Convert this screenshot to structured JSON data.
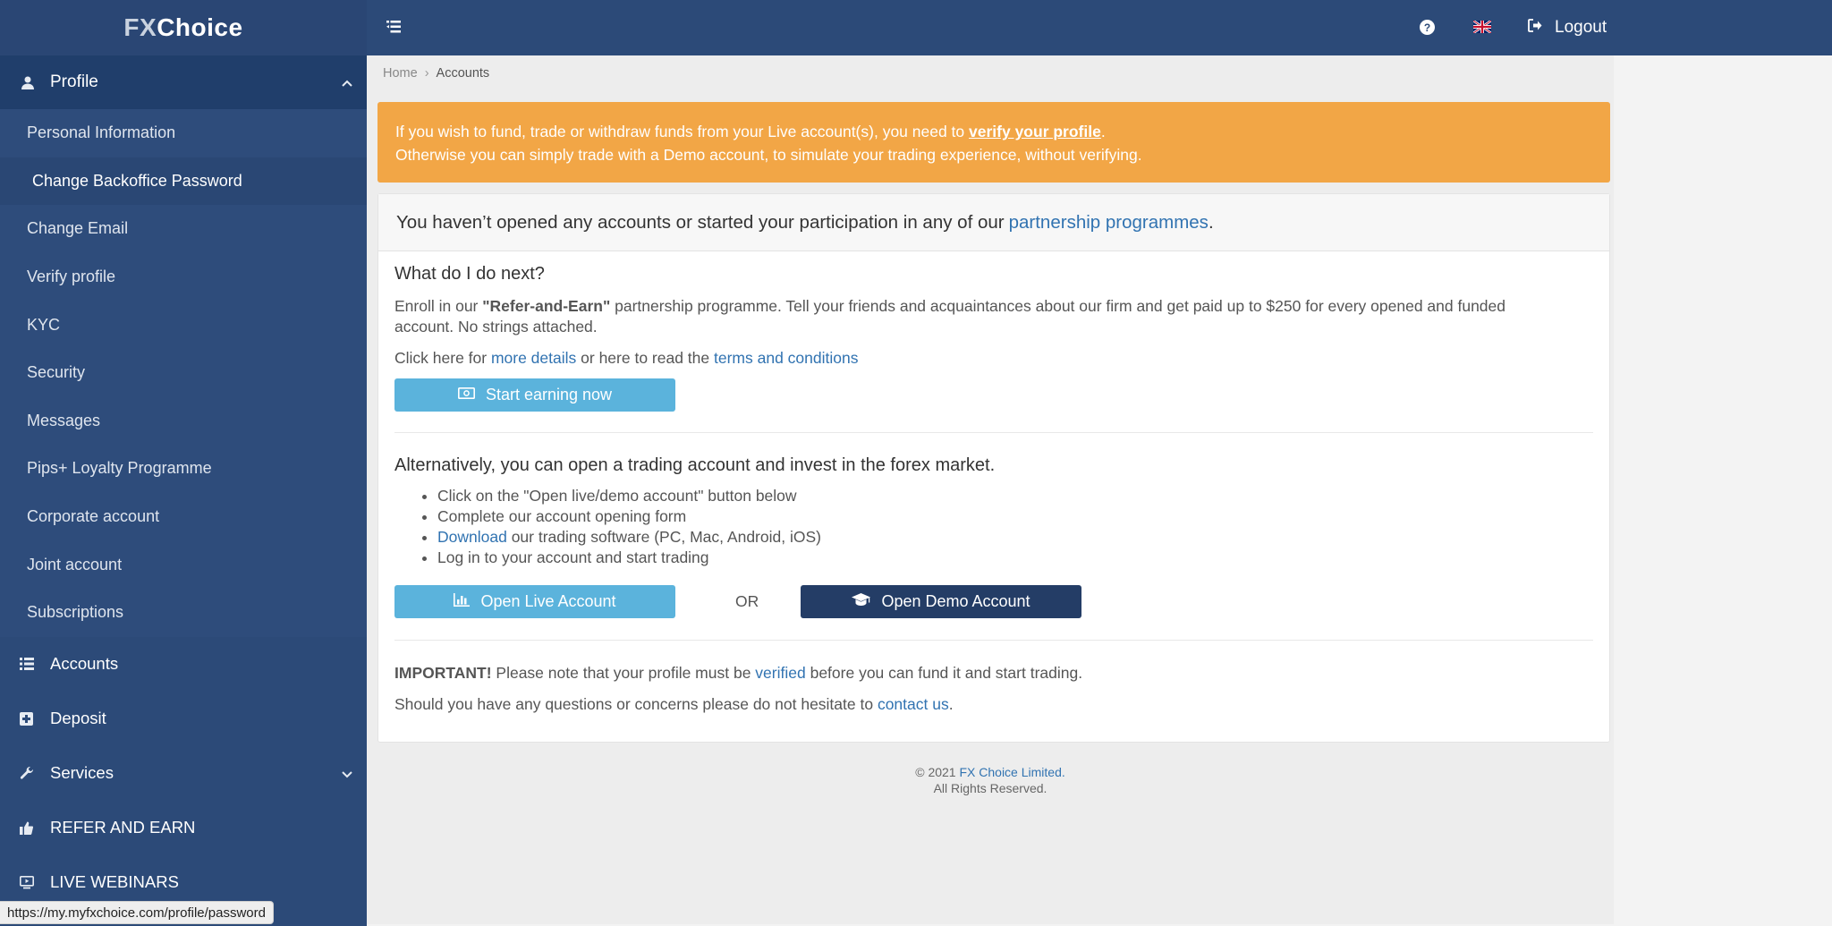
{
  "brand": {
    "fx": "FX",
    "choice": "Choice"
  },
  "sidebar": {
    "profile_label": "Profile",
    "profile_items": [
      "Personal Information",
      "Change Backoffice Password",
      "Change Email",
      "Verify profile",
      "KYC",
      "Security",
      "Messages",
      "Pips+ Loyalty Programme",
      "Corporate account",
      "Joint account",
      "Subscriptions"
    ],
    "accounts_label": "Accounts",
    "deposit_label": "Deposit",
    "services_label": "Services",
    "refer_label": "REFER AND EARN",
    "webinars_label": "LIVE WEBINARS"
  },
  "topbar": {
    "help": "?",
    "logout_label": "Logout"
  },
  "breadcrumb": {
    "home": "Home",
    "separator": "›",
    "current": "Accounts"
  },
  "alert": {
    "line1_prefix": "If you wish to fund, trade or withdraw funds from your Live account(s), you need to ",
    "line1_link": "verify your profile",
    "line1_suffix": ".",
    "line2": "Otherwise you can simply trade with a Demo account, to simulate your trading experience, without verifying."
  },
  "panel": {
    "head_prefix": "You haven’t opened any accounts or started your participation in any of our ",
    "head_link": "partnership programmes",
    "head_suffix": ".",
    "next_title": "What do I do next?",
    "enroll_prefix": "Enroll in our ",
    "enroll_strong": "\"Refer-and-Earn\"",
    "enroll_suffix": " partnership programme. Tell your friends and acquaintances about our firm and get paid up to $250 for every opened and funded",
    "enroll_line2": "account. No strings attached.",
    "click_prefix": "Click here for ",
    "more_details": "more details",
    "click_mid": " or here to read the ",
    "terms": "terms and conditions",
    "start_earning": "Start earning now",
    "alt_title": "Alternatively, you can open a trading account and invest in the forex market.",
    "steps": [
      "Click on the \"Open live/demo account\" button below",
      "Complete our account opening form",
      "our trading software (PC, Mac, Android, iOS)",
      "Log in to your account and start trading"
    ],
    "download_link": "Download",
    "open_live": "Open Live Account",
    "or": "OR",
    "open_demo": "Open Demo Account",
    "important_strong": "IMPORTANT!",
    "important_prefix": " Please note that your profile must be ",
    "verified_link": "verified",
    "important_suffix": " before you can fund it and start trading.",
    "questions_prefix": "Should you have any questions or concerns please do not hesitate to ",
    "contact_link": "contact us",
    "questions_suffix": "."
  },
  "footer": {
    "copy_prefix": "© 2021 ",
    "company_link": "FX Choice Limited.",
    "rights": "All Rights Reserved."
  },
  "status_url": "https://my.myfxchoice.com/profile/password",
  "colors": {
    "sidebar": "#2c4a78",
    "alert": "#f2a646",
    "btn_light": "#5bb3dc",
    "btn_dark": "#243d66",
    "link": "#3173b1"
  }
}
